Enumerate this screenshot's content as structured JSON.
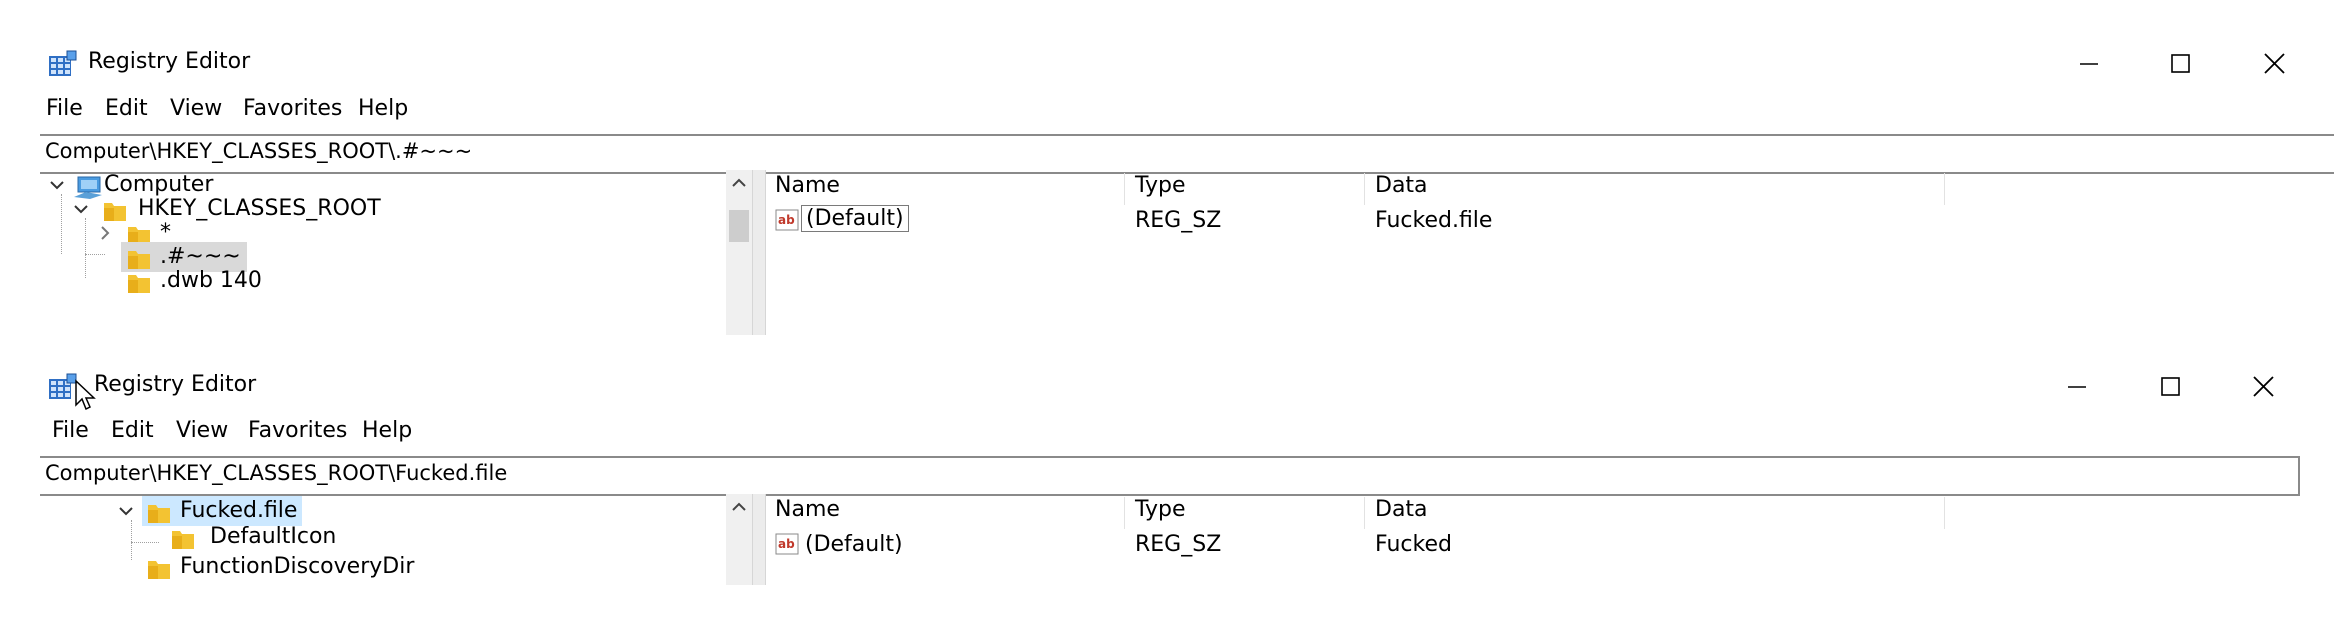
{
  "win1": {
    "title": "Registry Editor",
    "menu": [
      "File",
      "Edit",
      "View",
      "Favorites",
      "Help"
    ],
    "address": "Computer\\HKEY_CLASSES_ROOT\\.#~~~",
    "tree": {
      "computer": "Computer",
      "hkcr": "HKEY_CLASSES_ROOT",
      "star": "*",
      "selected": ".#~~~",
      "cut_off": ".dwb 140"
    },
    "columns": {
      "name": "Name",
      "type": "Type",
      "data": "Data"
    },
    "rows": [
      {
        "name": "(Default)",
        "type": "REG_SZ",
        "data": "Fucked.file"
      }
    ]
  },
  "win2": {
    "title": "Registry Editor",
    "menu": [
      "File",
      "Edit",
      "View",
      "Favorites",
      "Help"
    ],
    "address": "Computer\\HKEY_CLASSES_ROOT\\Fucked.file",
    "tree": {
      "selected": "Fucked.file",
      "child": "DefaultIcon",
      "cut_off": "FunctionDiscoveryDir"
    },
    "columns": {
      "name": "Name",
      "type": "Type",
      "data": "Data"
    },
    "rows": [
      {
        "name": "(Default)",
        "type": "REG_SZ",
        "data": "Fucked"
      }
    ]
  },
  "colors": {
    "selection": "#cce8ff",
    "selection_inactive": "#d9d9d9",
    "folder": "#f3c332",
    "border": "#8a8a8a"
  },
  "icons": [
    "regedit-app-icon",
    "minimize-icon",
    "maximize-icon",
    "close-icon",
    "chevron-down-icon",
    "chevron-right-icon",
    "folder-icon",
    "computer-icon",
    "string-value-icon",
    "scroll-up-arrow-icon",
    "mouse-cursor-icon"
  ]
}
